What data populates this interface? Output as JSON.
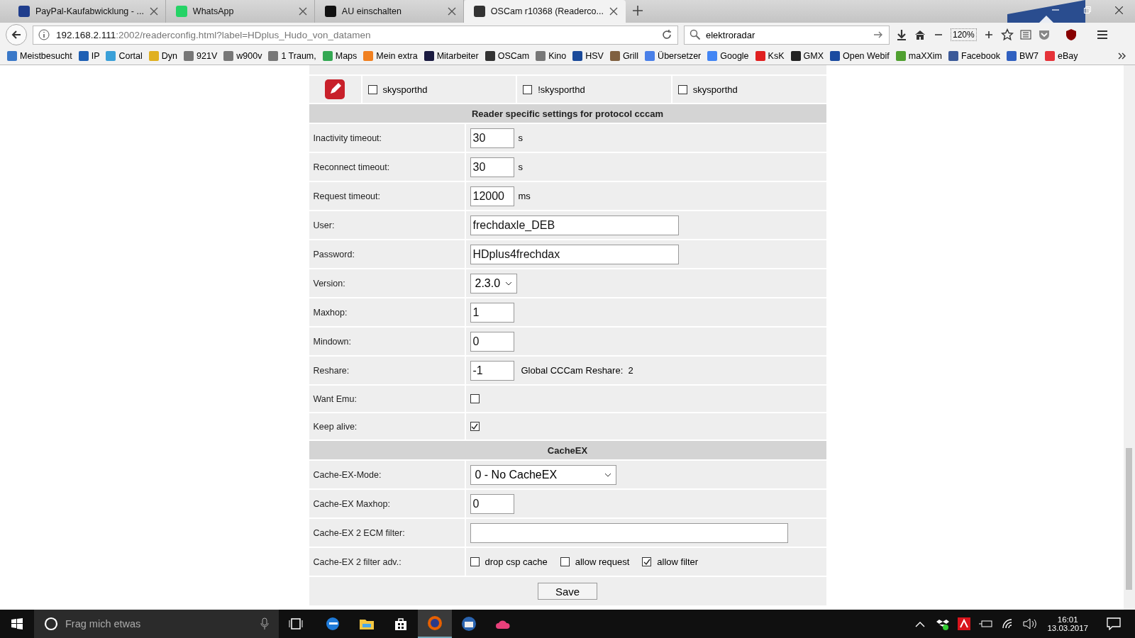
{
  "tabs": [
    {
      "title": "PayPal-Kaufabwicklung - ...",
      "selected": false
    },
    {
      "title": "WhatsApp",
      "selected": false
    },
    {
      "title": "AU einschalten",
      "selected": false
    },
    {
      "title": "OSCam r10368 (Readerco...",
      "selected": true
    }
  ],
  "url": {
    "host": "192.168.2.111",
    "rest": ":2002/readerconfig.html?label=HDplus_Hudo_von_datamen"
  },
  "search": {
    "value": "elektroradar"
  },
  "zoom": "120%",
  "bookmarks": [
    {
      "label": "Meistbesucht",
      "color": "#3a78c8"
    },
    {
      "label": "IP",
      "color": "#1e5fb4"
    },
    {
      "label": "Cortal",
      "color": "#3aa0d8"
    },
    {
      "label": "Dyn",
      "color": "#e0b020"
    },
    {
      "label": "921V",
      "color": "#777777"
    },
    {
      "label": "w900v",
      "color": "#777777"
    },
    {
      "label": "1 Traum,",
      "color": "#777777"
    },
    {
      "label": "Maps",
      "color": "#34a853"
    },
    {
      "label": "Mein extra",
      "color": "#f08020"
    },
    {
      "label": "Mitarbeiter",
      "color": "#1a1a40"
    },
    {
      "label": "OSCam",
      "color": "#333333"
    },
    {
      "label": "Kino",
      "color": "#777777"
    },
    {
      "label": "HSV",
      "color": "#1a4a9a"
    },
    {
      "label": "Grill",
      "color": "#806040"
    },
    {
      "label": "Übersetzer",
      "color": "#4a80e8"
    },
    {
      "label": "Google",
      "color": "#4285f4"
    },
    {
      "label": "KsK",
      "color": "#e02020"
    },
    {
      "label": "GMX",
      "color": "#222222"
    },
    {
      "label": "Open Webif",
      "color": "#1a4aa0"
    },
    {
      "label": "maXXim",
      "color": "#50a030"
    },
    {
      "label": "Facebook",
      "color": "#3b5998"
    },
    {
      "label": "BW7",
      "color": "#3060c0"
    },
    {
      "label": "eBay",
      "color": "#e53238"
    }
  ],
  "filter_row": [
    {
      "label": "skysporthd",
      "checked": false
    },
    {
      "label": "!skysporthd",
      "checked": false
    },
    {
      "label": "skysporthd",
      "checked": false
    }
  ],
  "sections": [
    {
      "title": "Reader specific settings for protocol cccam",
      "rows": [
        {
          "kind": "number",
          "label": "Inactivity timeout:",
          "value": "30",
          "unit": "s"
        },
        {
          "kind": "number",
          "label": "Reconnect timeout:",
          "value": "30",
          "unit": "s"
        },
        {
          "kind": "number",
          "label": "Request timeout:",
          "value": "12000",
          "unit": "ms"
        },
        {
          "kind": "text",
          "label": "User:",
          "value": "frechdaxle_DEB"
        },
        {
          "kind": "text",
          "label": "Password:",
          "value": "HDplus4frechdax"
        },
        {
          "kind": "version",
          "label": "Version:",
          "value": "2.3.0"
        },
        {
          "kind": "number",
          "label": "Maxhop:",
          "value": "1"
        },
        {
          "kind": "number",
          "label": "Mindown:",
          "value": "0"
        },
        {
          "kind": "number",
          "label": "Reshare:",
          "value": "-1",
          "note": "Global CCCam Reshare:  2"
        },
        {
          "kind": "checkbox",
          "label": "Want Emu:",
          "checked": false
        },
        {
          "kind": "checkbox",
          "label": "Keep alive:",
          "checked": true
        }
      ]
    },
    {
      "title": "CacheEX",
      "rows": [
        {
          "kind": "mode",
          "label": "Cache-EX-Mode:",
          "value": "0 - No CacheEX"
        },
        {
          "kind": "number",
          "label": "Cache-EX Maxhop:",
          "value": "0"
        },
        {
          "kind": "filter",
          "label": "Cache-EX 2 ECM filter:"
        },
        {
          "kind": "checks",
          "label": "Cache-EX 2 filter adv.:",
          "options": [
            {
              "label": "drop csp cache",
              "checked": false
            },
            {
              "label": "allow request",
              "checked": false
            },
            {
              "label": "allow filter",
              "checked": true
            }
          ]
        }
      ]
    }
  ],
  "save": "Save",
  "taskbar": {
    "search_placeholder": "Frag mich etwas",
    "time": "16:01",
    "date": "13.03.2017",
    "apps": [
      {
        "selected": false
      },
      {
        "selected": false
      },
      {
        "selected": false
      },
      {
        "selected": true
      },
      {
        "selected": false
      },
      {
        "selected": false
      }
    ]
  }
}
